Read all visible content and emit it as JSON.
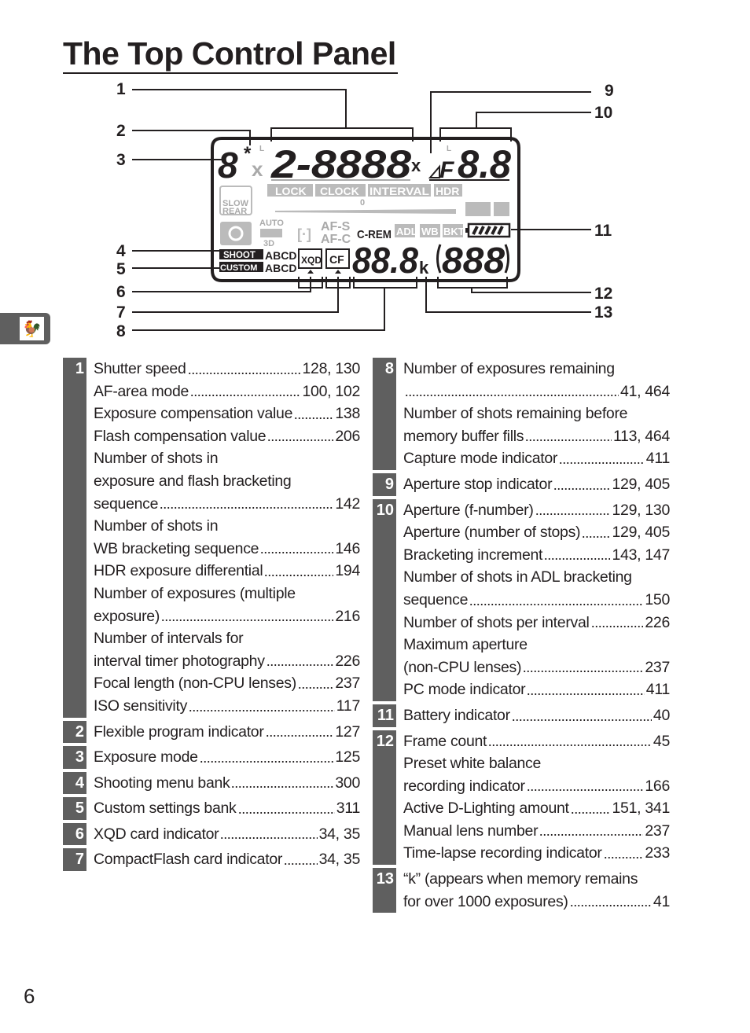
{
  "title": "The Top Control Panel",
  "page_number": "6",
  "side_tab_icon": "weathervane-rooster-icon",
  "diagram": {
    "callouts": [
      "1",
      "2",
      "3",
      "4",
      "5",
      "6",
      "7",
      "8",
      "9",
      "10",
      "11",
      "12",
      "13"
    ],
    "lcd": {
      "mode": "8",
      "flex": "*",
      "x_left": "x",
      "shutter_digits": "2-8888",
      "x_right": "x",
      "l_left": "L",
      "l_right": "L",
      "aperture_prefix": "F",
      "aperture_digits": "8.8",
      "lock": "LOCK",
      "clock": "CLOCK",
      "interval": "INTERVAL",
      "hdr": "HDR",
      "slow": "SLOW",
      "rear": "REAR",
      "zero": "0",
      "auto": "AUTO",
      "three_d": "3D",
      "afs": "AF-S",
      "afc": "AF-C",
      "crem": "C-REM",
      "adl": "ADL",
      "wb": "WB",
      "bkt": "BKT",
      "shoot": "SHOOT",
      "custom": "CUSTOM",
      "bank1": "ABCD",
      "bank2": "ABCD",
      "xqd": "XQD",
      "cf": "CF",
      "count_digits": "88.8",
      "k": "k",
      "frame_digits": "888"
    }
  },
  "left_entries": [
    {
      "num": "1",
      "lines": [
        {
          "text": "Shutter speed",
          "pages": "128, 130"
        },
        {
          "text": "AF-area mode",
          "pages": "100, 102"
        },
        {
          "text": "Exposure compensation value",
          "pages": "138"
        },
        {
          "text": "Flash compensation value",
          "pages": "206"
        },
        {
          "text": "Number of shots in"
        },
        {
          "text": "exposure and flash bracketing"
        },
        {
          "text": "sequence",
          "pages": "142"
        },
        {
          "text": "Number of shots in"
        },
        {
          "text": "WB bracketing sequence",
          "pages": "146"
        },
        {
          "text": "HDR exposure differential",
          "pages": "194"
        },
        {
          "text": "Number of exposures (multiple"
        },
        {
          "text": "exposure)",
          "pages": "216"
        },
        {
          "text": "Number of intervals for"
        },
        {
          "text": "interval timer photography",
          "pages": "226"
        },
        {
          "text": "Focal length (non-CPU lenses)",
          "pages": "237"
        },
        {
          "text": "ISO sensitivity",
          "pages": "117"
        }
      ]
    },
    {
      "num": "2",
      "lines": [
        {
          "text": "Flexible program indicator",
          "pages": "127"
        }
      ]
    },
    {
      "num": "3",
      "lines": [
        {
          "text": "Exposure mode",
          "pages": "125"
        }
      ]
    },
    {
      "num": "4",
      "lines": [
        {
          "text": "Shooting menu bank",
          "pages": "300"
        }
      ]
    },
    {
      "num": "5",
      "lines": [
        {
          "text": "Custom settings bank",
          "pages": "311"
        }
      ]
    },
    {
      "num": "6",
      "lines": [
        {
          "text": "XQD card indicator",
          "pages": "34, 35"
        }
      ]
    },
    {
      "num": "7",
      "lines": [
        {
          "text": "CompactFlash card indicator",
          "pages": "34, 35"
        }
      ]
    }
  ],
  "right_entries": [
    {
      "num": "8",
      "lines": [
        {
          "text": "Number of exposures remaining"
        },
        {
          "text": "",
          "pages": "41, 464"
        },
        {
          "text": "Number of shots remaining before"
        },
        {
          "text": "memory buffer fills",
          "pages": "113, 464"
        },
        {
          "text": "Capture mode indicator",
          "pages": "411"
        }
      ]
    },
    {
      "num": "9",
      "lines": [
        {
          "text": "Aperture stop indicator",
          "pages": "129, 405"
        }
      ]
    },
    {
      "num": "10",
      "lines": [
        {
          "text": "Aperture (f-number)",
          "pages": "129, 130"
        },
        {
          "text": "Aperture (number of stops)",
          "pages": "129, 405"
        },
        {
          "text": "Bracketing increment",
          "pages": "143, 147"
        },
        {
          "text": "Number of shots in ADL bracketing"
        },
        {
          "text": "sequence",
          "pages": "150"
        },
        {
          "text": "Number of shots per interval",
          "pages": "226"
        },
        {
          "text": "Maximum aperture"
        },
        {
          "text": "(non-CPU lenses)",
          "pages": "237"
        },
        {
          "text": "PC mode indicator",
          "pages": "411"
        }
      ]
    },
    {
      "num": "11",
      "lines": [
        {
          "text": "Battery indicator",
          "pages": "40"
        }
      ]
    },
    {
      "num": "12",
      "lines": [
        {
          "text": "Frame count",
          "pages": "45"
        },
        {
          "text": "Preset white balance"
        },
        {
          "text": "recording indicator",
          "pages": "166"
        },
        {
          "text": "Active D-Lighting amount",
          "pages": "151, 341"
        },
        {
          "text": "Manual lens number",
          "pages": "237"
        },
        {
          "text": "Time-lapse recording indicator",
          "pages": "233"
        }
      ]
    },
    {
      "num": "13",
      "lines": [
        {
          "text": "“k” (appears when memory remains"
        },
        {
          "text": "for over 1000 exposures)",
          "pages": "41"
        }
      ]
    }
  ]
}
